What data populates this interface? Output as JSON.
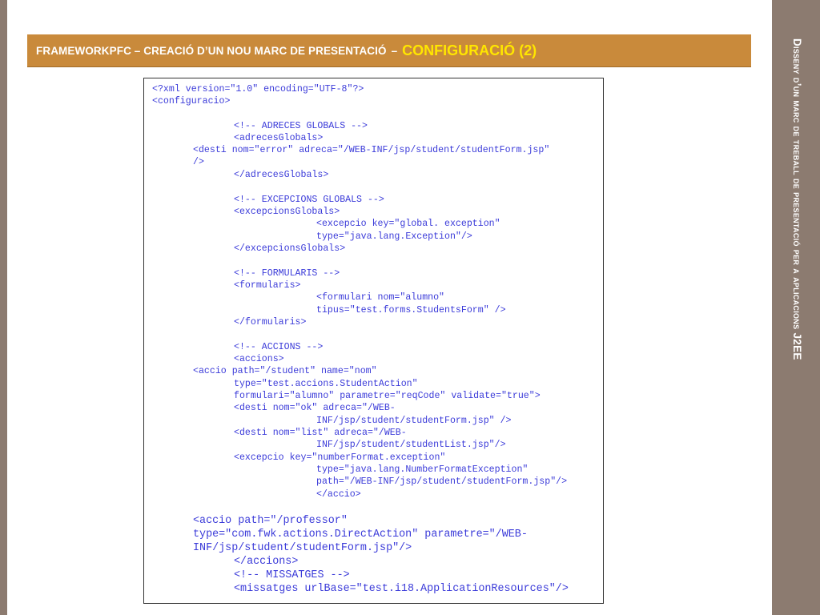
{
  "slide": {
    "title_main": "FRAMEWORKPFC – CREACIÓ D’UN NOU MARC DE PRESENTACIÓ",
    "title_separator": "–",
    "title_accent": "CONFIGURACIÓ (2)",
    "side_title": "Disseny d’un marc de treball de presentació per a aplicacions J2EE"
  },
  "colors": {
    "title_bar": "#c98a3b",
    "title_accent": "#ffe600",
    "side_panel": "#8c7b70",
    "code_text": "#3b3bd9"
  },
  "code_lines": [
    "<?xml version=\"1.0\" encoding=\"UTF-8\"?>",
    "<configuracio>",
    "<!-- ADRECES GLOBALS -->",
    "<adrecesGlobals>",
    "<desti nom=\"error\" adreca=\"/WEB-INF/jsp/student/studentForm.jsp\"",
    "/>",
    "</adrecesGlobals>",
    "<!-- EXCEPCIONS GLOBALS -->",
    "<excepcionsGlobals>",
    "<excepcio key=\"global. exception\"",
    "type=\"java.lang.Exception\"/>",
    "</excepcionsGlobals>",
    "<!-- FORMULARIS -->",
    "<formularis>",
    "<formulari nom=\"alumno\"",
    "tipus=\"test.forms.StudentsForm\" />",
    "</formularis>",
    "<!-- ACCIONS -->",
    "<accions>",
    "<accio path=\"/student\" name=\"nom\"",
    "type=\"test.accions.StudentAction\"",
    "formulari=\"alumno\" parametre=\"reqCode\" validate=\"true\">",
    "<desti nom=\"ok\" adreca=\"/WEB-",
    "INF/jsp/student/studentForm.jsp\" />",
    "<desti nom=\"list\" adreca=\"/WEB-",
    "INF/jsp/student/studentList.jsp\"/>",
    "<excepcio key=\"numberFormat.exception\"",
    "type=\"java.lang.NumberFormatException\"",
    "path=\"/WEB-INF/jsp/student/studentForm.jsp\"/>",
    "</accio>",
    "<accio path=\"/professor\"",
    "type=\"com.fwk.actions.DirectAction\" parametre=\"/WEB-",
    "INF/jsp/student/studentForm.jsp\"/>",
    "</accions>",
    "<!-- MISSATGES -->",
    "<missatges urlBase=\"test.i18.ApplicationResources\"/>"
  ]
}
